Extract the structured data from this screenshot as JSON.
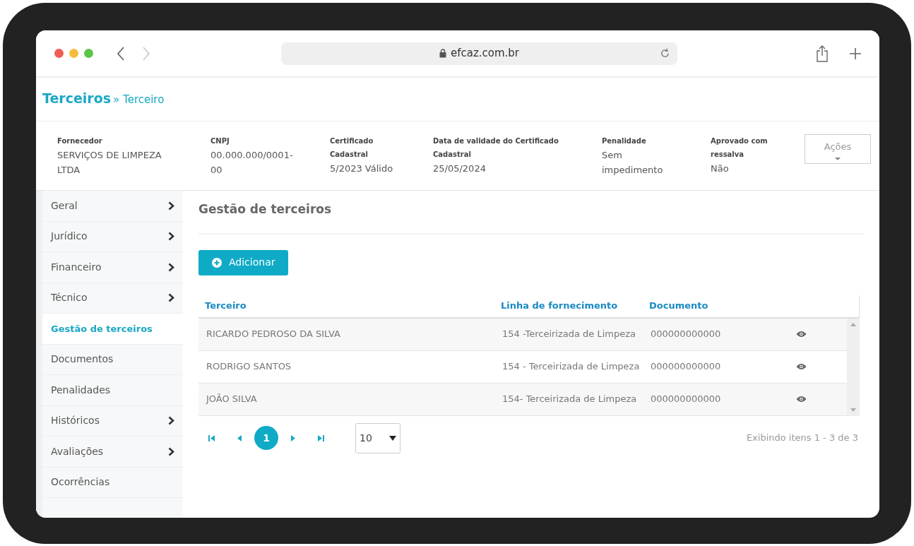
{
  "browser": {
    "url": "efcaz.com.br"
  },
  "breadcrumb": {
    "title": "Terceiros",
    "separator": "»",
    "current": "Terceiro"
  },
  "supplier_info": [
    {
      "label": "Fornecedor",
      "value": "SERVIÇOS DE LIMPEZA LTDA"
    },
    {
      "label": "CNPJ",
      "value": "00.000.000/0001-00"
    },
    {
      "label": "Certificado Cadastral",
      "value": "5/2023 Válido"
    },
    {
      "label": "Data de validade do Certificado Cadastral",
      "value": "25/05/2024"
    },
    {
      "label": "Penalidade",
      "value": "Sem impedimento"
    },
    {
      "label": "Aprovado com ressalva",
      "value": "Não"
    }
  ],
  "actions_button": "Ações",
  "sidebar": {
    "items": [
      {
        "label": "Geral",
        "has_submenu": true,
        "selected": false
      },
      {
        "label": "Jurídico",
        "has_submenu": true,
        "selected": false
      },
      {
        "label": "Financeiro",
        "has_submenu": true,
        "selected": false
      },
      {
        "label": "Técnico",
        "has_submenu": true,
        "selected": false
      },
      {
        "label": "Gestão de terceiros",
        "has_submenu": false,
        "selected": true
      },
      {
        "label": "Documentos",
        "has_submenu": false,
        "selected": false
      },
      {
        "label": "Penalidades",
        "has_submenu": false,
        "selected": false
      },
      {
        "label": "Históricos",
        "has_submenu": true,
        "selected": false
      },
      {
        "label": "Avaliações",
        "has_submenu": true,
        "selected": false
      },
      {
        "label": "Ocorrências",
        "has_submenu": false,
        "selected": false
      }
    ]
  },
  "content": {
    "title": "Gestão de terceiros",
    "add_button": "Adicionar"
  },
  "table": {
    "columns": [
      "Terceiro",
      "Linha de fornecimento",
      "Documento"
    ],
    "rows": [
      {
        "cells": [
          "RICARDO PEDROSO DA SILVA",
          "154 -Terceirizada de Limpeza",
          "000000000000"
        ]
      },
      {
        "cells": [
          "RODRIGO SANTOS",
          "154 - Terceirizada de Limpeza",
          "000000000000"
        ]
      },
      {
        "cells": [
          "JOÃO SILVA",
          "154- Terceirizada de Limpeza",
          "000000000000"
        ]
      }
    ]
  },
  "pagination": {
    "pages": [
      {
        "label": "1",
        "selected": true
      }
    ],
    "page_size": "10",
    "summary": "Exibindo itens 1 - 3 de 3"
  }
}
